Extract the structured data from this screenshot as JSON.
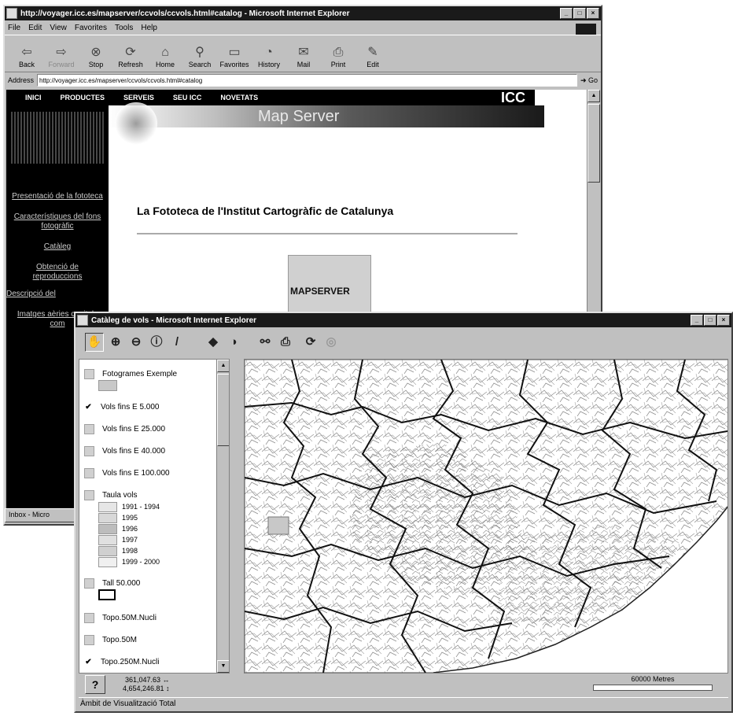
{
  "browser1": {
    "title": "http://voyager.icc.es/mapserver/ccvols/ccvols.html#catalog - Microsoft Internet Explorer",
    "menu": [
      "File",
      "Edit",
      "View",
      "Favorites",
      "Tools",
      "Help"
    ],
    "toolbar": [
      "Back",
      "Forward",
      "Stop",
      "Refresh",
      "Home",
      "Search",
      "Favorites",
      "History",
      "Mail",
      "Print",
      "Edit"
    ],
    "address_label": "Address",
    "address_value": "http://voyager.icc.es/mapserver/ccvols/ccvols.html#catalog",
    "go_label": "Go",
    "nav": [
      "INICI",
      "PRODUCTES",
      "SERVEIS",
      "SEU ICC",
      "NOVETATS"
    ],
    "icc": "ICC",
    "banner": "Map Server",
    "sidebar_links": [
      "Presentació de la fototeca",
      "Característiques del fons fotogràfic",
      "Catàleg",
      "Obtenció de reproduccions",
      "Descripció del",
      "Imatges aèries capitals com"
    ],
    "heading": "La Fototeca de l'Institut Cartogràfic de Catalunya",
    "logo_text": "MAPSERVER",
    "taskbar": "Inbox - Micro"
  },
  "browser2": {
    "title": "Catàleg de vols - Microsoft Internet Explorer",
    "legend": {
      "fotogrames": "Fotogrames Exemple",
      "layers": [
        "Vols fins E 5.000",
        "Vols fins E 25.000",
        "Vols fins E 40.000",
        "Vols fins E 100.000"
      ],
      "checked": [
        true,
        false,
        false,
        false
      ],
      "taula": "Taula vols",
      "years": [
        "1991 - 1994",
        "1995",
        "1996",
        "1997",
        "1998",
        "1999 - 2000"
      ],
      "tall": "Tall 50.000",
      "extra": [
        "Topo.50M.Nucli",
        "Topo.50M",
        "Topo.250M.Nucli"
      ],
      "extra_checked": [
        false,
        false,
        true
      ]
    },
    "help": "?",
    "coord_x": "361,047.63 ↔",
    "coord_y": "4,654,246.81 ↕",
    "scale": "60000 Metres",
    "status": "Àmbit de Visualització Total"
  }
}
